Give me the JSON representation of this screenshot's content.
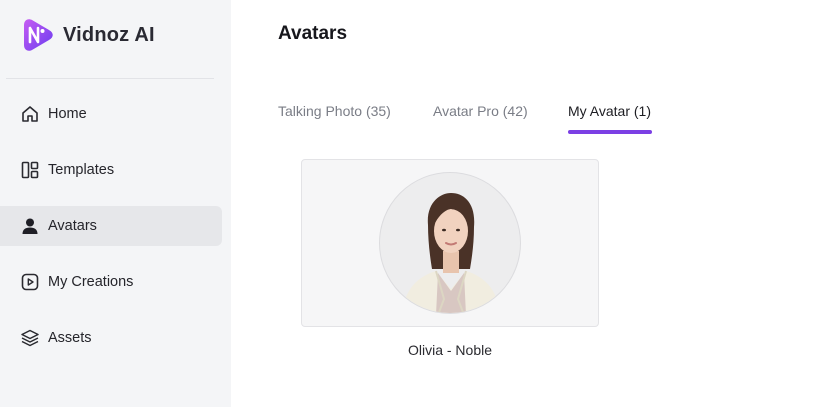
{
  "brand": {
    "name": "Vidnoz AI"
  },
  "sidebar": {
    "items": [
      {
        "label": "Home",
        "icon": "home-icon",
        "active": false
      },
      {
        "label": "Templates",
        "icon": "templates-icon",
        "active": false
      },
      {
        "label": "Avatars",
        "icon": "user-icon",
        "active": true
      },
      {
        "label": "My Creations",
        "icon": "play-square-icon",
        "active": false
      },
      {
        "label": "Assets",
        "icon": "layers-icon",
        "active": false
      }
    ]
  },
  "main": {
    "title": "Avatars",
    "tabs": [
      {
        "label": "Talking Photo (35)",
        "active": false
      },
      {
        "label": "Avatar Pro (42)",
        "active": false
      },
      {
        "label": "My Avatar (1)",
        "active": true
      }
    ],
    "avatars": [
      {
        "name": "Olivia - Noble"
      }
    ]
  },
  "colors": {
    "accent": "#7b3fe4",
    "sidebar_bg": "#f4f5f7",
    "active_item_bg": "#e6e7ea"
  }
}
